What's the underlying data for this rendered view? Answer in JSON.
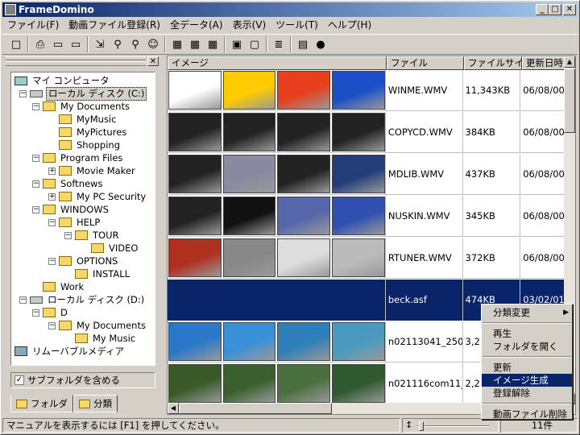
{
  "window": {
    "title": "FrameDomino",
    "btn_min": "_",
    "btn_max": "□",
    "btn_close": "✕"
  },
  "menus": [
    "ファイル(F)",
    "動画ファイル登録(R)",
    "全データ(A)",
    "表示(V)",
    "ツール(T)",
    "ヘルプ(H)"
  ],
  "toolbar": [
    [
      "page-icon",
      "□"
    ],
    [
      "sep",
      ""
    ],
    [
      "print-icon",
      "⎙"
    ],
    [
      "monitor-icon",
      "▭"
    ],
    [
      "window-icon",
      "▭"
    ],
    [
      "sep",
      ""
    ],
    [
      "import-icon",
      "⇲"
    ],
    [
      "search-icon",
      "⚲"
    ],
    [
      "search-icon",
      "⚲"
    ],
    [
      "people-icon",
      "☺"
    ],
    [
      "sep",
      ""
    ],
    [
      "grid1-icon",
      "▦"
    ],
    [
      "grid2-icon",
      "▦"
    ],
    [
      "grid3-icon",
      "▦"
    ],
    [
      "sep",
      ""
    ],
    [
      "view1-icon",
      "▣"
    ],
    [
      "view2-icon",
      "▢"
    ],
    [
      "sep",
      ""
    ],
    [
      "list-icon",
      "≣"
    ],
    [
      "sep",
      ""
    ],
    [
      "book-icon",
      "▤"
    ],
    [
      "globe-icon",
      "●"
    ]
  ],
  "tree": [
    {
      "label": "マイ コンピュータ",
      "icon": "pc",
      "d": 0,
      "exp": ""
    },
    {
      "label": "ローカル ディスク (C:)",
      "icon": "drive",
      "d": 1,
      "exp": "−",
      "sel": true
    },
    {
      "label": "My Documents",
      "icon": "folder",
      "d": 2,
      "exp": "−"
    },
    {
      "label": "MyMusic",
      "icon": "folder",
      "d": 3,
      "exp": ""
    },
    {
      "label": "MyPictures",
      "icon": "folder",
      "d": 3,
      "exp": ""
    },
    {
      "label": "Shopping",
      "icon": "folder",
      "d": 3,
      "exp": ""
    },
    {
      "label": "Program Files",
      "icon": "folder",
      "d": 2,
      "exp": "−"
    },
    {
      "label": "Movie Maker",
      "icon": "folder",
      "d": 3,
      "exp": "+"
    },
    {
      "label": "Softnews",
      "icon": "folder",
      "d": 2,
      "exp": "−"
    },
    {
      "label": "My PC Security",
      "icon": "folder",
      "d": 3,
      "exp": "+"
    },
    {
      "label": "WINDOWS",
      "icon": "folder",
      "d": 2,
      "exp": "−"
    },
    {
      "label": "HELP",
      "icon": "folder",
      "d": 3,
      "exp": "−"
    },
    {
      "label": "TOUR",
      "icon": "folder",
      "d": 4,
      "exp": "−"
    },
    {
      "label": "VIDEO",
      "icon": "folder",
      "d": 5,
      "exp": ""
    },
    {
      "label": "OPTIONS",
      "icon": "folder",
      "d": 3,
      "exp": "−"
    },
    {
      "label": "INSTALL",
      "icon": "folder",
      "d": 4,
      "exp": ""
    },
    {
      "label": "Work",
      "icon": "folder",
      "d": 2,
      "exp": ""
    },
    {
      "label": "ローカル ディスク (D:)",
      "icon": "drive",
      "d": 1,
      "exp": "−"
    },
    {
      "label": "D",
      "icon": "folder",
      "d": 2,
      "exp": "−"
    },
    {
      "label": "My Documents",
      "icon": "folder",
      "d": 3,
      "exp": "−"
    },
    {
      "label": "My Music",
      "icon": "folder",
      "d": 4,
      "exp": ""
    },
    {
      "label": "リムーバブルメディア",
      "icon": "removable",
      "d": 0,
      "exp": ""
    }
  ],
  "left_panel": {
    "close": "✕",
    "subfolder_label": "サブフォルダを含める",
    "check": "✓",
    "tab_folder": "フォルダ",
    "tab_category": "分類"
  },
  "columns": [
    "イメージ",
    "ファイル",
    "ファイルサイズ",
    "更新日時"
  ],
  "rows": [
    {
      "file": "WINME.WMV",
      "size": "11,343KB",
      "date": "06/08/00",
      "thumbs": [
        "#fff",
        "#ffcc00",
        "#e8401c",
        "#1a4fc8"
      ]
    },
    {
      "file": "COPYCD.WMV",
      "size": "384KB",
      "date": "06/08/00",
      "thumbs": [
        "#222",
        "#222",
        "#222",
        "#222"
      ]
    },
    {
      "file": "MDLIB.WMV",
      "size": "437KB",
      "date": "06/08/00",
      "thumbs": [
        "#222",
        "#8a8aa0",
        "#222",
        "#233c7a"
      ]
    },
    {
      "file": "NUSKIN.WMV",
      "size": "345KB",
      "date": "06/08/00",
      "thumbs": [
        "#222",
        "#111",
        "#5566aa",
        "#3050b0"
      ]
    },
    {
      "file": "RTUNER.WMV",
      "size": "372KB",
      "date": "06/08/00",
      "thumbs": [
        "#b03020",
        "#888",
        "#ddd",
        "#bbb"
      ]
    },
    {
      "file": "beck.asf",
      "size": "474KB",
      "date": "03/02/01",
      "thumbs": [],
      "sel": true
    },
    {
      "file": "n02113041_250k...",
      "size": "3,2",
      "date": "",
      "thumbs": [
        "#2a78c8",
        "#3a90d8",
        "#2f7fb8",
        "#4a9ac0"
      ]
    },
    {
      "file": "n021116com11_5...",
      "size": "2,2",
      "date": "",
      "thumbs": [
        "#3a5a2a",
        "#3a6030",
        "#4a7040",
        "#2f5a30"
      ]
    }
  ],
  "scroll": {
    "up": "▲",
    "down": "▼",
    "left": "◀",
    "right": "▶"
  },
  "status": {
    "text": "マニュアルを表示するには [F1] を押してください。",
    "count": "11件",
    "slider_icon": "↕"
  },
  "context_menu": [
    {
      "label": "分類変更",
      "arrow": "▶"
    },
    {
      "sep": true
    },
    {
      "label": "再生"
    },
    {
      "label": "フォルダを開く"
    },
    {
      "sep": true
    },
    {
      "label": "更新"
    },
    {
      "label": "イメージ生成",
      "hl": true
    },
    {
      "label": "登録解除"
    },
    {
      "sep": true
    },
    {
      "label": "動画ファイル削除"
    }
  ]
}
